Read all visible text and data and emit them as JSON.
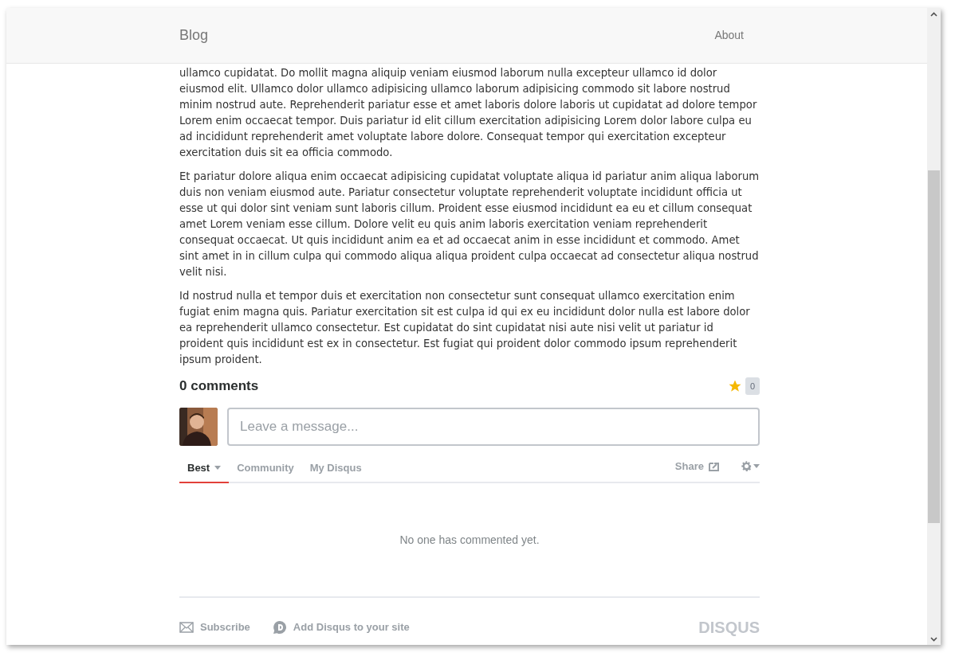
{
  "header": {
    "brand": "Blog",
    "nav": [
      {
        "label": "About"
      }
    ]
  },
  "paragraphs": [
    "ullamco cupidatat. Do mollit magna aliquip veniam eiusmod laborum nulla excepteur ullamco id dolor eiusmod elit. Ullamco dolor ullamco adipisicing ullamco laborum adipisicing commodo sit labore nostrud minim nostrud aute. Reprehenderit pariatur esse et amet laboris dolore laboris ut cupidatat ad dolore tempor Lorem enim occaecat tempor. Duis pariatur id elit cillum exercitation adipisicing Lorem dolor labore culpa eu ad incididunt reprehenderit amet voluptate labore dolore. Consequat tempor qui exercitation excepteur exercitation duis sit ea officia commodo.",
    "Et pariatur dolore aliqua enim occaecat adipisicing cupidatat voluptate aliqua id pariatur anim aliqua laborum duis non veniam eiusmod aute. Pariatur consectetur voluptate reprehenderit voluptate incididunt officia ut esse ut qui dolor sint veniam sunt laboris cillum. Proident esse eiusmod incididunt ea eu et cillum consequat amet Lorem veniam esse cillum. Dolore velit eu quis anim laboris exercitation veniam reprehenderit consequat occaecat. Ut quis incididunt anim ea et ad occaecat anim in esse incididunt et commodo. Amet sint amet in in cillum culpa qui commodo aliqua aliqua proident culpa occaecat ad consectetur aliqua nostrud velit nisi.",
    "Id nostrud nulla et tempor duis et exercitation non consectetur sunt consequat ullamco exercitation enim fugiat enim magna quis. Pariatur exercitation sit est culpa id qui ex eu incididunt dolor nulla est labore dolor ea reprehenderit ullamco consectetur. Est cupidatat do sint cupidatat nisi aute nisi velit ut pariatur id proident quis incididunt est ex in consectetur. Est fugiat qui proident dolor commodo ipsum reprehenderit ipsum proident."
  ],
  "comments": {
    "count_label": "0 comments",
    "recommend_count": "0",
    "message_field": {
      "placeholder": "Leave a message..."
    },
    "tabs": [
      {
        "label": "Best",
        "selected": true,
        "dropdown": true
      },
      {
        "label": "Community",
        "selected": false,
        "dropdown": false
      },
      {
        "label": "My Disqus",
        "selected": false,
        "dropdown": false
      }
    ],
    "share": "Share",
    "empty_message": "No one has commented yet.",
    "footer": {
      "subscribe": "Subscribe",
      "add_disqus": "Add Disqus to your site",
      "logo": "DISQUS"
    }
  }
}
